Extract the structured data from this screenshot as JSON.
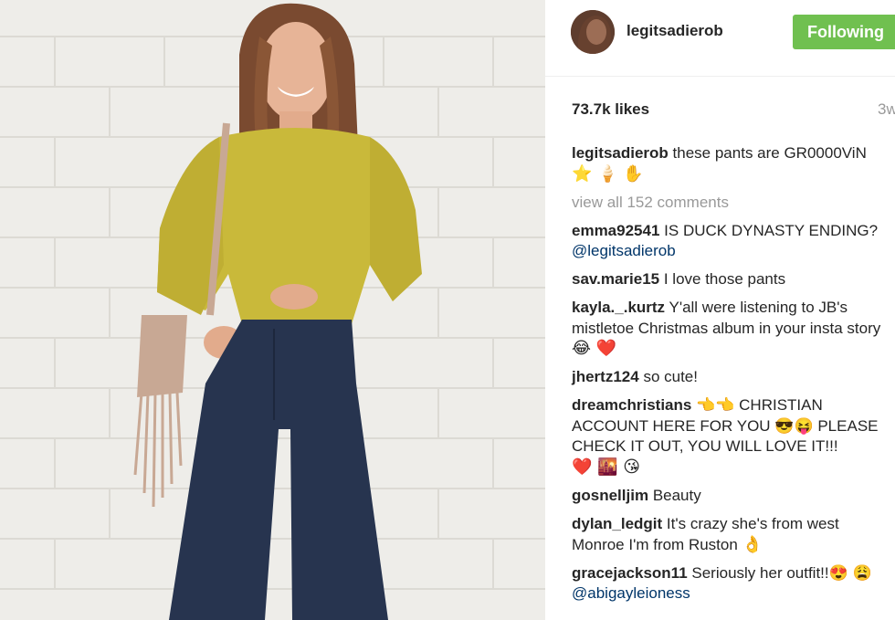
{
  "post": {
    "username": "legitsadierob",
    "follow_label": "Following",
    "likes": "73.7k likes",
    "time_ago": "3w",
    "caption_user": "legitsadierob",
    "caption_text": "these pants are GR0000ViN",
    "caption_emoji": "⭐ 🍦 ✋",
    "view_all": "view all 152 comments"
  },
  "comments": [
    {
      "user": "emma92541",
      "text": "IS DUCK DYNASTY ENDING?",
      "mention": "@legitsadierob",
      "emoji": ""
    },
    {
      "user": "sav.marie15",
      "text": "I love those pants",
      "mention": "",
      "emoji": ""
    },
    {
      "user": "kayla._.kurtz",
      "text": "Y'all were listening to JB's mistletoe Christmas album in your insta story",
      "mention": "",
      "emoji": "😂 ❤️"
    },
    {
      "user": "jhertz124",
      "text": "so cute!",
      "mention": "",
      "emoji": ""
    },
    {
      "user": "dreamchristians",
      "text": "👈👈 CHRISTIAN ACCOUNT HERE FOR YOU 😎😝 PLEASE CHECK IT OUT, YOU WILL LOVE IT!!!",
      "mention": "",
      "emoji": "❤️ 🌇 😘"
    },
    {
      "user": "gosnelljim",
      "text": "Beauty",
      "mention": "",
      "emoji": ""
    },
    {
      "user": "dylan_ledgit",
      "text": "It's crazy she's from west Monroe I'm from Ruston",
      "mention": "",
      "emoji": "👌"
    },
    {
      "user": "gracejackson11",
      "text": "Seriously her outfit!!😍 😩",
      "mention": "@abigayleioness",
      "emoji": ""
    }
  ],
  "colors": {
    "follow_button": "#70c050",
    "mention": "#003569",
    "muted_text": "#999999",
    "sweater": "#c9b93a",
    "jeans": "#27344f",
    "bag": "#c8a894"
  },
  "icons": {
    "avatar": "profile-avatar-image"
  }
}
